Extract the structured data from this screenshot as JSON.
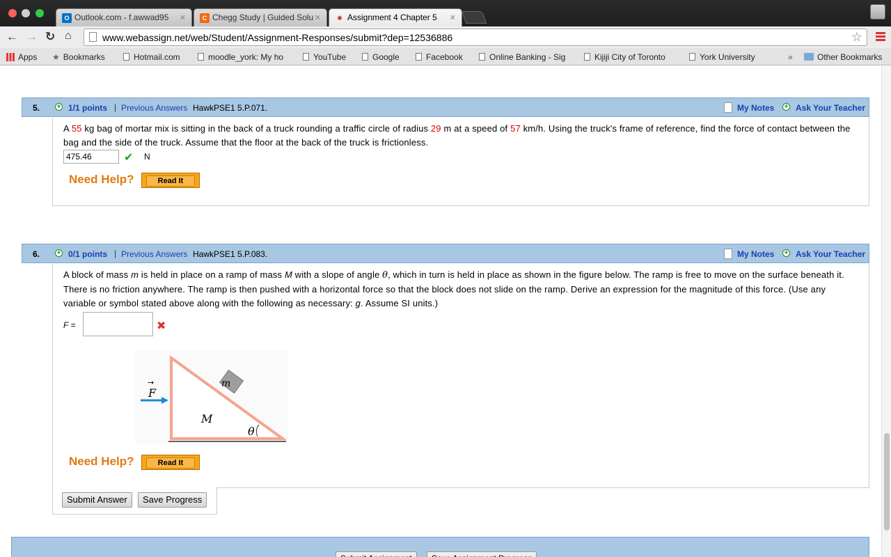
{
  "tabs": [
    {
      "label": "Outlook.com - f.awwad95",
      "icon": "outlook-icon",
      "color": "#0072c6"
    },
    {
      "label": "Chegg Study | Guided Solu",
      "icon": "chegg-icon",
      "color": "#f26a12"
    },
    {
      "label": "Assignment 4 Chapter 5",
      "icon": "webassign-icon",
      "color": "#cc2222"
    }
  ],
  "address_bar": {
    "url": "www.webassign.net/web/Student/Assignment-Responses/submit?dep=12536886"
  },
  "bookmarks": [
    {
      "label": "Apps"
    },
    {
      "label": "Bookmarks"
    },
    {
      "label": "Hotmail.com"
    },
    {
      "label": "moodle_york: My ho"
    },
    {
      "label": "YouTube"
    },
    {
      "label": "Google"
    },
    {
      "label": "Facebook"
    },
    {
      "label": "Online Banking - Sig"
    },
    {
      "label": "Kijiji City of Toronto"
    },
    {
      "label": "York University"
    },
    {
      "label": "»"
    },
    {
      "label": "Other Bookmarks"
    }
  ],
  "questions": [
    {
      "number": "5.",
      "points": "1/1 points",
      "separator": "|",
      "previous_answers": "Previous Answers",
      "code": "HawkPSE1 5.P.071.",
      "my_notes": "My Notes",
      "ask_teacher": "Ask Your Teacher",
      "text_parts": [
        "A ",
        "55",
        " kg bag of mortar mix is sitting in the back of a truck rounding a traffic circle of radius ",
        "29",
        " m at a speed of ",
        "57",
        " km/h. Using the truck's frame of reference, find the force of contact between the bag and the side of the truck. Assume that the floor at the back of the truck is frictionless."
      ],
      "answer_value": "475.46",
      "answer_unit": "N",
      "status": "correct",
      "need_help": "Need Help?",
      "read_it": "Read It"
    },
    {
      "number": "6.",
      "points": "0/1 points",
      "separator": "|",
      "previous_answers": "Previous Answers",
      "code": "HawkPSE1 5.P.083.",
      "my_notes": "My Notes",
      "ask_teacher": "Ask Your Teacher",
      "text_parts": [
        "A block of mass ",
        "m",
        " is held in place on a ramp of mass ",
        "M",
        " with a slope of angle ",
        "θ",
        ", which in turn is held in place as shown in the figure below. The ramp is free to move on the surface beneath it. There is no friction anywhere. The ramp is then pushed with a horizontal force so that the block does not slide on the ramp. Derive an expression for the magnitude of this force. (Use any variable or symbol stated above along with the following as necessary: ",
        "g",
        ". Assume SI units.)"
      ],
      "answer_label": "F =",
      "answer_value": "",
      "status": "incorrect",
      "figure": {
        "force_label": "F",
        "block_label": "m",
        "ramp_label": "M",
        "angle_label": "θ"
      },
      "need_help": "Need Help?",
      "read_it": "Read It"
    }
  ],
  "actions": {
    "submit_answer": "Submit Answer",
    "save_progress": "Save Progress"
  },
  "bottom_bar": {
    "submit_assignment": "Submit Assignment",
    "save_assignment_progress": "Save Assignment Progress"
  },
  "colors": {
    "header_blue": "#a7c7e3",
    "link_blue": "#1a3fb0",
    "value_red": "#d00000",
    "help_orange": "#e07a10",
    "read_it_orange": "#f9a51b",
    "ramp_salmon": "#f4a58e",
    "force_arrow_blue": "#1a8ad0"
  }
}
